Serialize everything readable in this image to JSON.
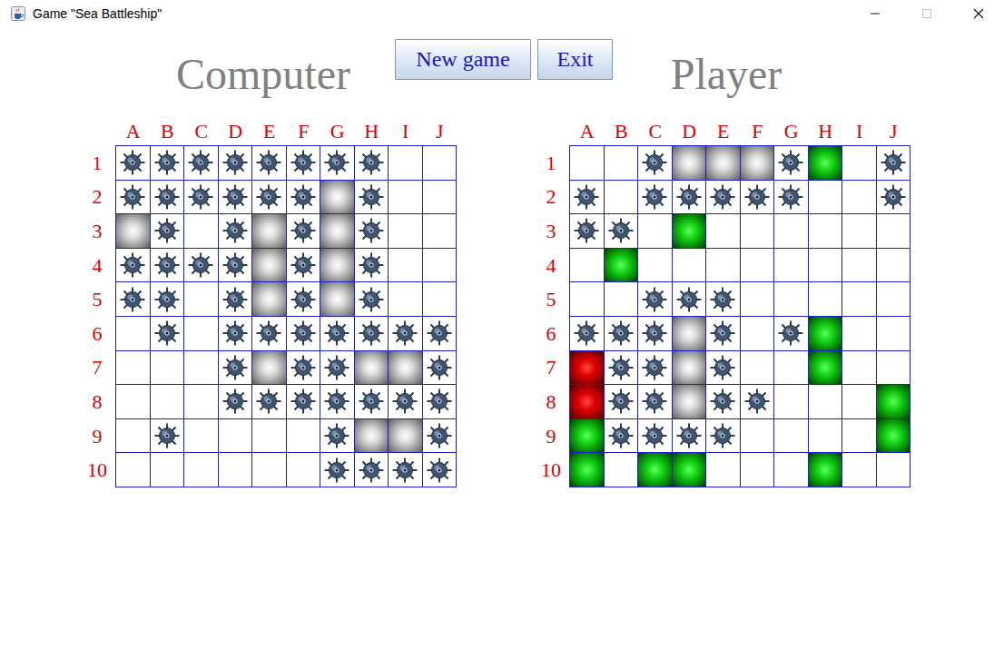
{
  "window": {
    "title": "Game \"Sea Battleship\"",
    "controls": [
      {
        "kind": "minimize",
        "disabled": false
      },
      {
        "kind": "maximize",
        "disabled": true
      },
      {
        "kind": "close",
        "disabled": false
      }
    ]
  },
  "buttons": [
    {
      "label": "New game"
    },
    {
      "label": "Exit"
    }
  ],
  "columns": [
    "A",
    "B",
    "C",
    "D",
    "E",
    "F",
    "G",
    "H",
    "I",
    "J"
  ],
  "rows": [
    "1",
    "2",
    "3",
    "4",
    "5",
    "6",
    "7",
    "8",
    "9",
    "10"
  ],
  "boards": [
    {
      "title": "Computer",
      "cells": [
        [
          "miss",
          "miss",
          "miss",
          "miss",
          "miss",
          "miss",
          "miss",
          "miss",
          "empty",
          "empty"
        ],
        [
          "miss",
          "miss",
          "miss",
          "miss",
          "miss",
          "miss",
          "hit",
          "miss",
          "empty",
          "empty"
        ],
        [
          "hit",
          "miss",
          "empty",
          "miss",
          "hit",
          "miss",
          "hit",
          "miss",
          "empty",
          "empty"
        ],
        [
          "miss",
          "miss",
          "miss",
          "miss",
          "hit",
          "miss",
          "hit",
          "miss",
          "empty",
          "empty"
        ],
        [
          "miss",
          "miss",
          "empty",
          "miss",
          "hit",
          "miss",
          "hit",
          "miss",
          "empty",
          "empty"
        ],
        [
          "empty",
          "miss",
          "empty",
          "miss",
          "miss",
          "miss",
          "miss",
          "miss",
          "miss",
          "miss"
        ],
        [
          "empty",
          "empty",
          "empty",
          "miss",
          "hit",
          "miss",
          "miss",
          "hit",
          "hit",
          "miss"
        ],
        [
          "empty",
          "empty",
          "empty",
          "miss",
          "miss",
          "miss",
          "miss",
          "miss",
          "miss",
          "miss"
        ],
        [
          "empty",
          "miss",
          "empty",
          "empty",
          "empty",
          "empty",
          "miss",
          "hit",
          "hit",
          "miss"
        ],
        [
          "empty",
          "empty",
          "empty",
          "empty",
          "empty",
          "empty",
          "miss",
          "miss",
          "miss",
          "miss"
        ]
      ]
    },
    {
      "title": "Player",
      "cells": [
        [
          "empty",
          "empty",
          "miss",
          "hit",
          "hit",
          "hit",
          "miss",
          "ship",
          "empty",
          "miss"
        ],
        [
          "miss",
          "empty",
          "miss",
          "miss",
          "miss",
          "miss",
          "miss",
          "empty",
          "empty",
          "miss"
        ],
        [
          "miss",
          "miss",
          "empty",
          "ship",
          "empty",
          "empty",
          "empty",
          "empty",
          "empty",
          "empty"
        ],
        [
          "empty",
          "ship",
          "empty",
          "empty",
          "empty",
          "empty",
          "empty",
          "empty",
          "empty",
          "empty"
        ],
        [
          "empty",
          "empty",
          "miss",
          "miss",
          "miss",
          "empty",
          "empty",
          "empty",
          "empty",
          "empty"
        ],
        [
          "miss",
          "miss",
          "miss",
          "hit",
          "miss",
          "empty",
          "miss",
          "ship",
          "empty",
          "empty"
        ],
        [
          "damaged",
          "miss",
          "miss",
          "hit",
          "miss",
          "empty",
          "empty",
          "ship",
          "empty",
          "empty"
        ],
        [
          "damaged",
          "miss",
          "miss",
          "hit",
          "miss",
          "miss",
          "empty",
          "empty",
          "empty",
          "ship"
        ],
        [
          "ship",
          "miss",
          "miss",
          "miss",
          "miss",
          "empty",
          "empty",
          "empty",
          "empty",
          "ship"
        ],
        [
          "ship",
          "empty",
          "ship",
          "ship",
          "empty",
          "empty",
          "empty",
          "ship",
          "empty",
          "empty"
        ]
      ]
    }
  ]
}
